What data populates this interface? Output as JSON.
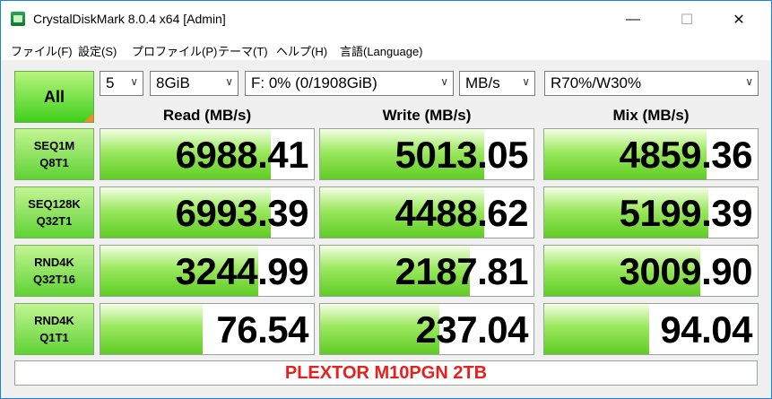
{
  "window": {
    "title": "CrystalDiskMark 8.0.4 x64 [Admin]",
    "controls": {
      "minimize": "—",
      "maximize": "☐",
      "close": "✕"
    }
  },
  "menu": [
    "ファイル(F)",
    "設定(S)",
    "プロファイル(P)",
    "テーマ(T)",
    "ヘルプ(H)",
    "言語(Language)"
  ],
  "toolbar": {
    "all_label": "All",
    "count": "5",
    "size": "8GiB",
    "drive": "F: 0% (0/1908GiB)",
    "unit": "MB/s",
    "mix": "R70%/W30%"
  },
  "columns": {
    "read": "Read (MB/s)",
    "write": "Write (MB/s)",
    "mix": "Mix (MB/s)"
  },
  "tests": [
    {
      "line1": "SEQ1M",
      "line2": "Q8T1",
      "read": "6988.41",
      "write": "5013.05",
      "mix": "4859.36",
      "fill": [
        0.8,
        0.77,
        0.76
      ]
    },
    {
      "line1": "SEQ128K",
      "line2": "Q32T1",
      "read": "6993.39",
      "write": "4488.62",
      "mix": "5199.39",
      "fill": [
        0.8,
        0.77,
        0.77
      ]
    },
    {
      "line1": "RND4K",
      "line2": "Q32T16",
      "read": "3244.99",
      "write": "2187.81",
      "mix": "3009.90",
      "fill": [
        0.74,
        0.7,
        0.73
      ]
    },
    {
      "line1": "RND4K",
      "line2": "Q1T1",
      "read": "76.54",
      "write": "237.04",
      "mix": "94.04",
      "fill": [
        0.48,
        0.56,
        0.49
      ]
    }
  ],
  "comment": "PLEXTOR M10PGN 2TB",
  "colors": {
    "accent": "#1883d7",
    "bar": "#5fcc25",
    "comment": "#e8201c"
  }
}
